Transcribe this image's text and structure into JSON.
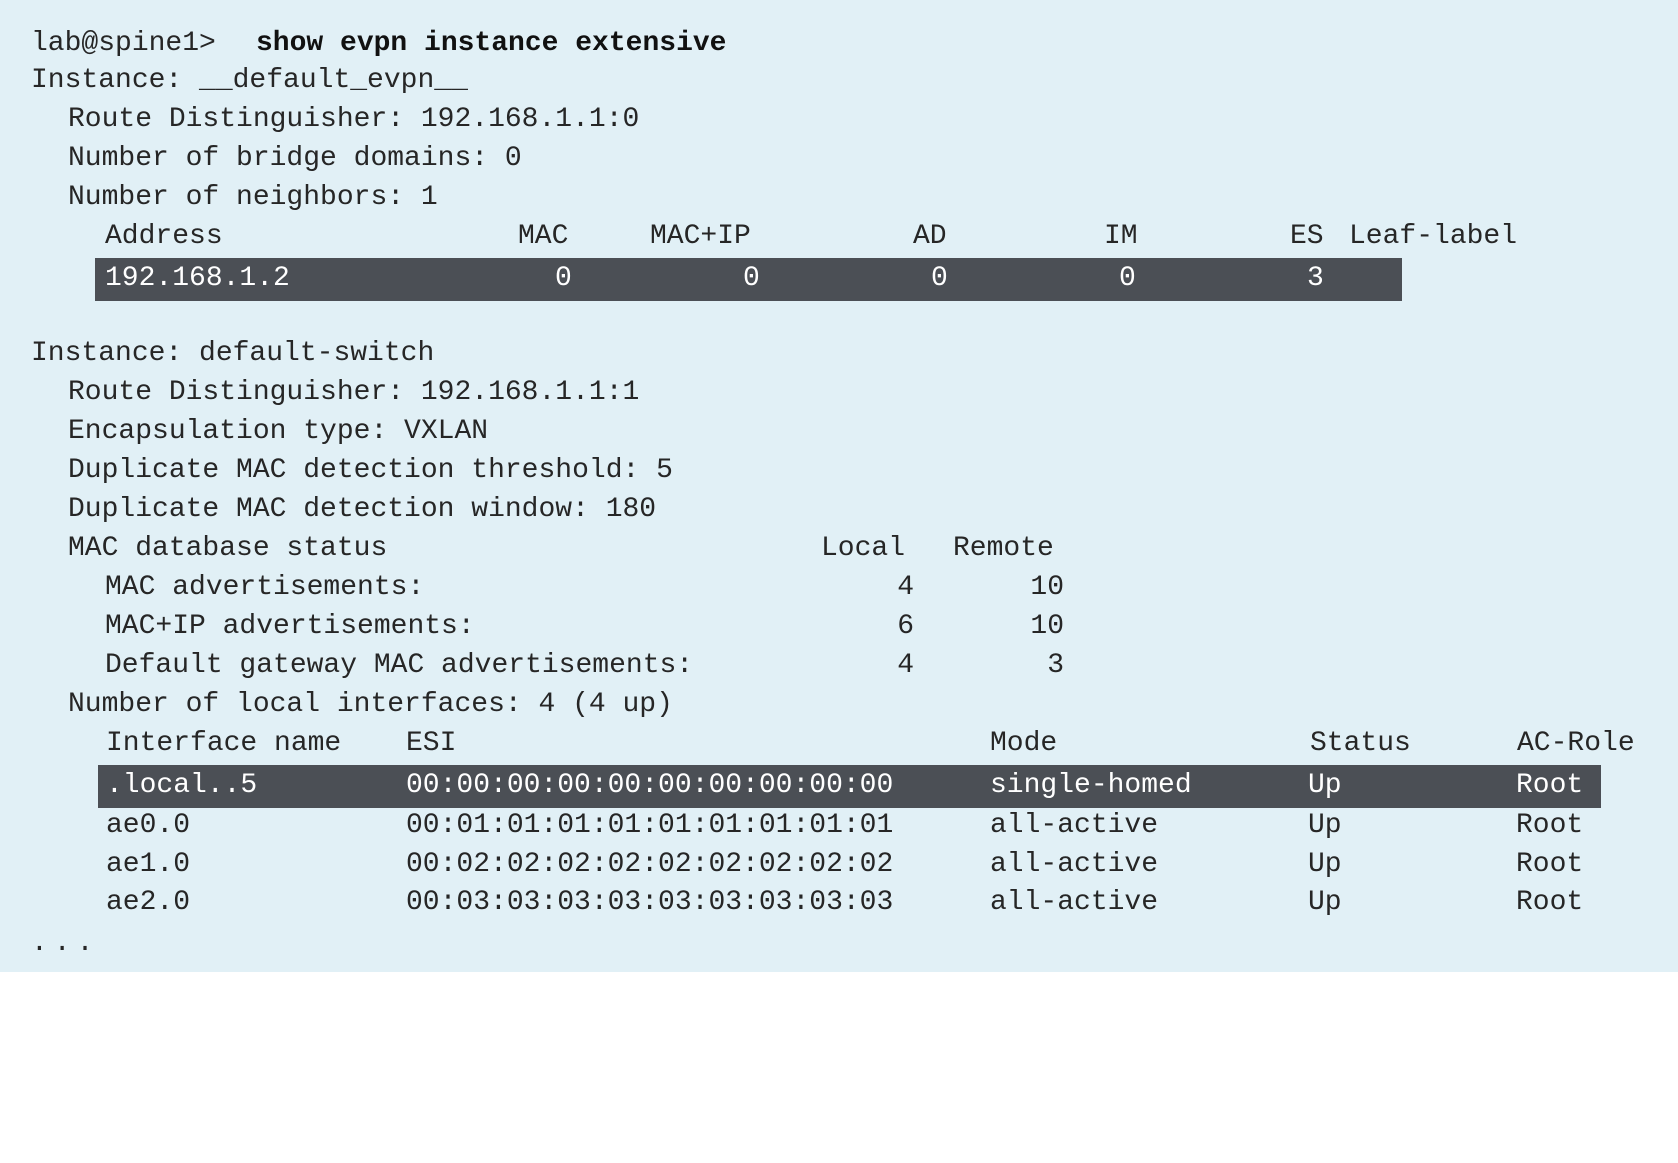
{
  "prompt": {
    "user_host": "lab@spine1>",
    "command": "show evpn instance extensive"
  },
  "instance1": {
    "header": "Instance: __default_evpn__",
    "rd": "Route Distinguisher: 192.168.1.1:0",
    "bridge_domains": "Number of bridge domains: 0",
    "neighbors": "Number of neighbors: 1",
    "table": {
      "columns": [
        "Address",
        "MAC",
        "MAC+IP",
        "AD",
        "IM",
        "ES",
        "Leaf-label"
      ],
      "row": {
        "address": "192.168.1.2",
        "mac": "0",
        "mac_ip": "0",
        "ad": "0",
        "im": "0",
        "es": "3",
        "leaf_label": ""
      }
    }
  },
  "instance2": {
    "header": "Instance: default-switch",
    "rd": "Route Distinguisher: 192.168.1.1:1",
    "encap": "Encapsulation type: VXLAN",
    "dup_threshold": "Duplicate MAC detection threshold: 5",
    "dup_window": "Duplicate MAC detection window: 180",
    "mac_db": {
      "title": "MAC database status",
      "col_local": "Local",
      "col_remote": "Remote",
      "rows": [
        {
          "label": "MAC advertisements:",
          "local": "4",
          "remote": "10"
        },
        {
          "label": "MAC+IP advertisements:",
          "local": "6",
          "remote": "10"
        },
        {
          "label": "Default gateway MAC advertisements:",
          "local": "4",
          "remote": "3"
        }
      ]
    },
    "local_interfaces": "Number of local interfaces: 4 (4 up)",
    "interfaces": {
      "columns": [
        "Interface name",
        "ESI",
        "Mode",
        "Status",
        "AC-Role"
      ],
      "rows": [
        {
          "name": ".local..5",
          "esi": "00:00:00:00:00:00:00:00:00:00",
          "mode": "single-homed",
          "status": "Up",
          "role": "Root"
        },
        {
          "name": "ae0.0",
          "esi": "00:01:01:01:01:01:01:01:01:01",
          "mode": "all-active",
          "status": "Up",
          "role": "Root"
        },
        {
          "name": "ae1.0",
          "esi": "00:02:02:02:02:02:02:02:02:02",
          "mode": "all-active",
          "status": "Up",
          "role": "Root"
        },
        {
          "name": "ae2.0",
          "esi": "00:03:03:03:03:03:03:03:03:03",
          "mode": "all-active",
          "status": "Up",
          "role": "Root"
        }
      ]
    }
  },
  "ellipsis": "...",
  "colors": {
    "background": "#e1f0f6",
    "text": "#262626",
    "highlight_bg": "#4b4f55",
    "highlight_text": "#ffffff"
  }
}
